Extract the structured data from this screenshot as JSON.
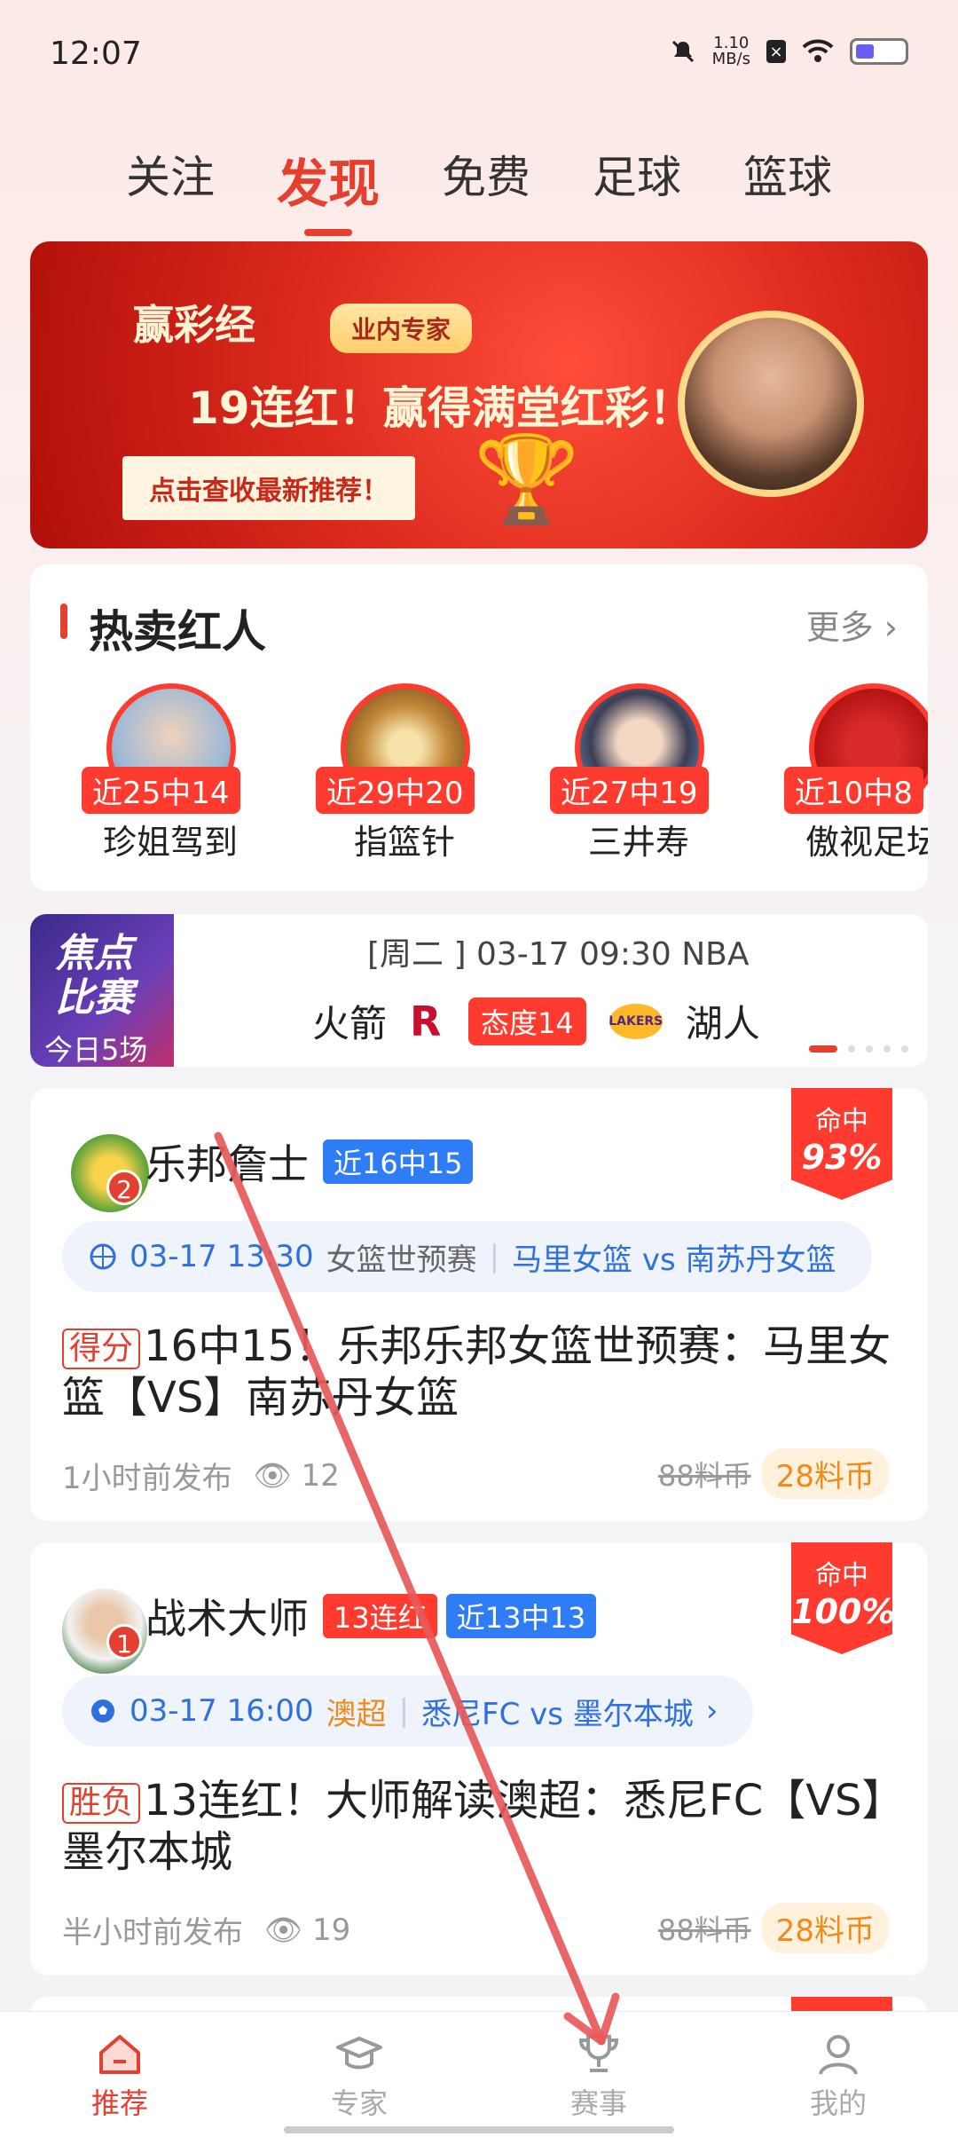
{
  "status": {
    "time": "12:07",
    "speed_top": "1.10",
    "speed_unit": "MB/s"
  },
  "tabs": [
    {
      "label": "关注"
    },
    {
      "label": "发现"
    },
    {
      "label": "免费"
    },
    {
      "label": "足球"
    },
    {
      "label": "篮球"
    }
  ],
  "banner": {
    "brand": "赢彩经",
    "pill": "业内专家",
    "headline": "19连红！赢得满堂红彩！",
    "cta": "点击查收最新推荐！"
  },
  "hot": {
    "title": "热卖红人",
    "more": "更多",
    "people": [
      {
        "badge": "近25中14",
        "name": "珍姐驾到"
      },
      {
        "badge": "近29中20",
        "name": "指篮针"
      },
      {
        "badge": "近27中19",
        "name": "三井寿"
      },
      {
        "badge": "近10中8",
        "name": "傲视足坛"
      }
    ]
  },
  "focus": {
    "label_line1": "焦点",
    "label_line2": "比赛",
    "today": "今日5场",
    "info": "[周二 ] 03-17 09:30 NBA",
    "home": "火箭",
    "attitude": "态度14",
    "away": "湖人",
    "lakers_logo_text": "LAKERS"
  },
  "posts": [
    {
      "author": "乐邦詹士",
      "rank": "2",
      "tags_red": [],
      "tags_blue": [
        "近16中15"
      ],
      "hit_label": "命中",
      "hit_value": "93%",
      "match_date": "03-17 13:30",
      "match_league": "女篮世预赛",
      "match_vs": "马里女篮 vs 南苏丹女篮",
      "kind": "得分",
      "title": "16中15！乐邦乐邦女篮世预赛：马里女篮【VS】南苏丹女篮",
      "published": "1小时前发布",
      "views": "12",
      "old_price": "88料币",
      "price": "28料币"
    },
    {
      "author": "战术大师",
      "rank": "1",
      "tags_red": [
        "13连红"
      ],
      "tags_blue": [
        "近13中13"
      ],
      "hit_label": "命中",
      "hit_value": "100%",
      "match_date": "03-17 16:00",
      "match_league": "澳超",
      "match_vs": "悉尼FC vs 墨尔本城",
      "kind": "胜负",
      "title": "13连红！大师解读澳超：悉尼FC【VS】墨尔本城",
      "published": "半小时前发布",
      "views": "19",
      "old_price": "88料币",
      "price": "28料币"
    }
  ],
  "nav": [
    {
      "label": "推荐",
      "icon": "home-icon"
    },
    {
      "label": "专家",
      "icon": "graduation-cap-icon"
    },
    {
      "label": "赛事",
      "icon": "trophy-icon"
    },
    {
      "label": "我的",
      "icon": "user-icon"
    }
  ],
  "colors": {
    "accent": "#e53f2f",
    "blue": "#2f7df6",
    "orange": "#f08a1a"
  }
}
